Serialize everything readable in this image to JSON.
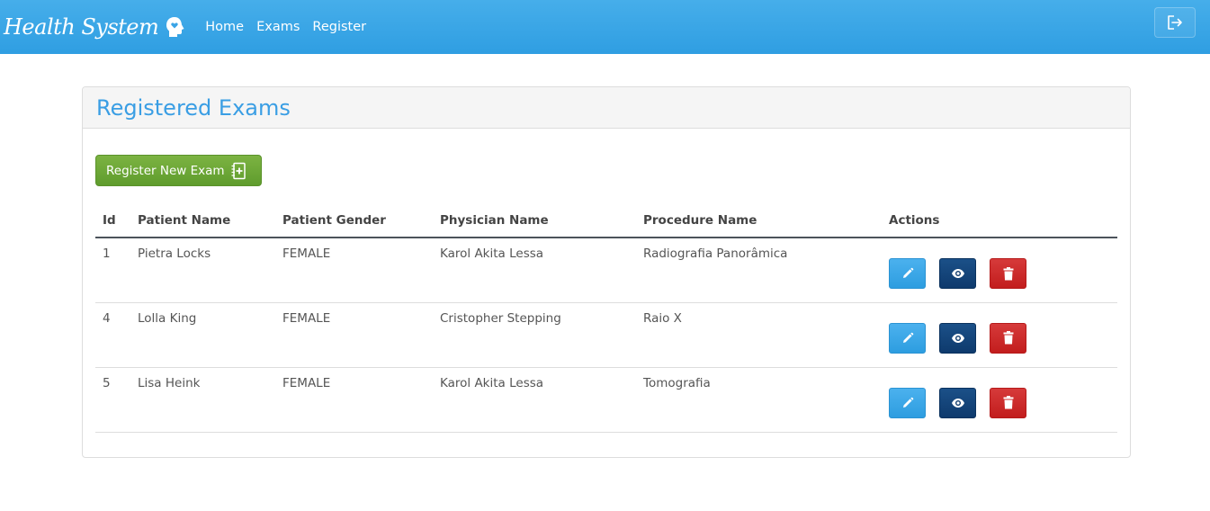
{
  "navbar": {
    "brand": "Health System",
    "brand_icon": "head-heart-icon",
    "links": [
      {
        "label": "Home"
      },
      {
        "label": "Exams"
      },
      {
        "label": "Register"
      }
    ],
    "logout_icon": "logout-icon"
  },
  "panel": {
    "title": "Registered Exams",
    "new_button": {
      "label": "Register New Exam",
      "icon": "notebook-plus-icon"
    }
  },
  "table": {
    "headers": [
      "Id",
      "Patient Name",
      "Patient Gender",
      "Physician Name",
      "Procedure Name",
      "Actions"
    ],
    "rows": [
      {
        "id": "1",
        "patient": "Pietra Locks",
        "gender": "FEMALE",
        "physician": "Karol Akita Lessa",
        "procedure": "Radiografia Panorâmica"
      },
      {
        "id": "4",
        "patient": "Lolla King",
        "gender": "FEMALE",
        "physician": "Cristopher Stepping",
        "procedure": "Raio X"
      },
      {
        "id": "5",
        "patient": "Lisa Heink",
        "gender": "FEMALE",
        "physician": "Karol Akita Lessa",
        "procedure": "Tomografia"
      }
    ],
    "action_icons": [
      "pencil-icon",
      "eye-icon",
      "trash-icon"
    ]
  },
  "colors": {
    "navbar": "#2f9ee2",
    "title": "#3a9ee4",
    "new_button": "#6aa834",
    "edit": "#2d9de0",
    "view": "#0e3a6d",
    "delete": "#c21d1d"
  }
}
